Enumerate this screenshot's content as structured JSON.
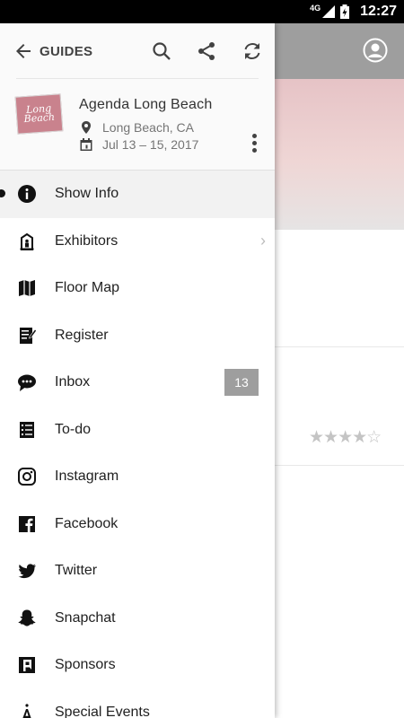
{
  "status_bar": {
    "network": "4G",
    "time": "12:27"
  },
  "background": {
    "rating": "★★★★☆"
  },
  "drawer": {
    "back_label": "GUIDES",
    "event": {
      "logo_text": "Long Beach",
      "title": "Agenda Long Beach",
      "location": "Long Beach, CA",
      "dates": "Jul 13 – 15, 2017"
    },
    "menu": [
      {
        "label": "Show Info",
        "icon": "info-icon",
        "active": true
      },
      {
        "label": "Exhibitors",
        "icon": "exhibitors-icon",
        "chevron": "›"
      },
      {
        "label": "Floor Map",
        "icon": "map-icon"
      },
      {
        "label": "Register",
        "icon": "register-icon"
      },
      {
        "label": "Inbox",
        "icon": "inbox-icon",
        "badge": "13"
      },
      {
        "label": "To-do",
        "icon": "todo-icon"
      },
      {
        "label": "Instagram",
        "icon": "instagram-icon"
      },
      {
        "label": "Facebook",
        "icon": "facebook-icon"
      },
      {
        "label": "Twitter",
        "icon": "twitter-icon"
      },
      {
        "label": "Snapchat",
        "icon": "snapchat-icon"
      },
      {
        "label": "Sponsors",
        "icon": "sponsors-icon"
      },
      {
        "label": "Special Events",
        "icon": "special-events-icon"
      }
    ]
  },
  "colors": {
    "badge": "#9e9e9e",
    "active_row": "#f2f2f2",
    "topbar": "#9e9e9e"
  }
}
